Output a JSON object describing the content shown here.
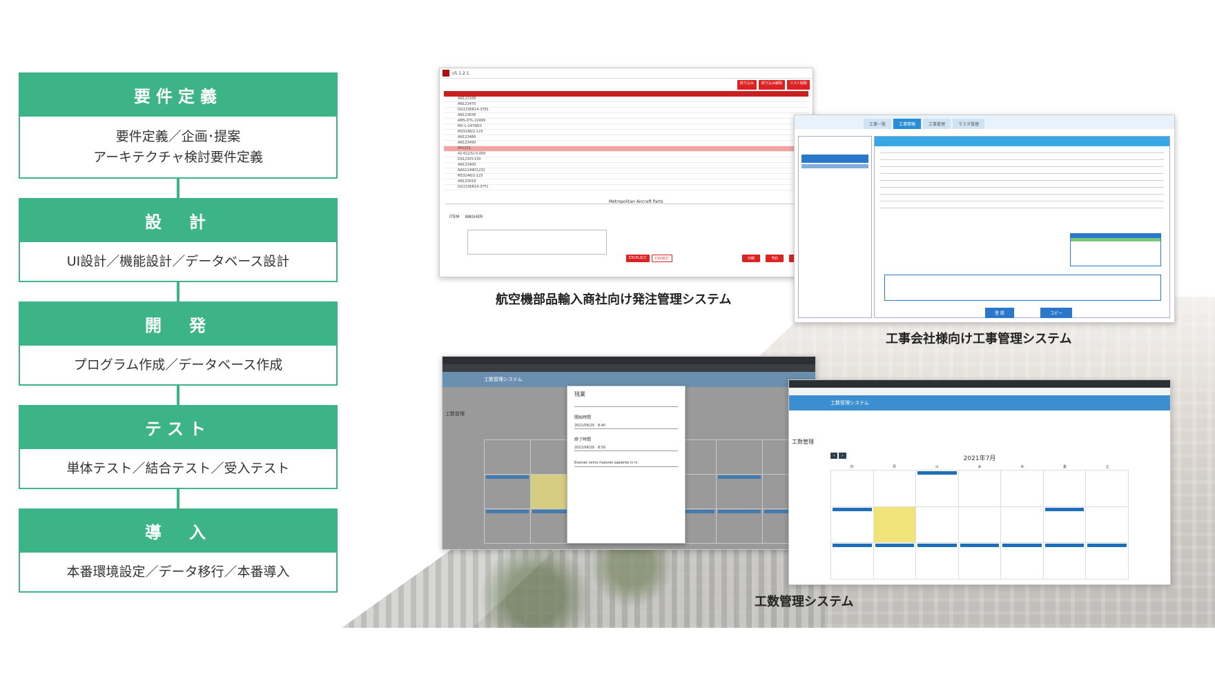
{
  "process_steps": [
    {
      "title": "要件定義",
      "lines": [
        "要件定義／企画･提案",
        "アーキテクチャ検討要件定義"
      ]
    },
    {
      "title": "設　計",
      "lines": [
        "UI設計／機能設計／データベース設計"
      ]
    },
    {
      "title": "開　発",
      "lines": [
        "プログラム作成／データベース作成"
      ]
    },
    {
      "title": "テスト",
      "lines": [
        "単体テスト／結合テスト／受入テスト"
      ]
    },
    {
      "title": "導　入",
      "lines": [
        "本番環境設定／データ移行／本番導入"
      ]
    }
  ],
  "systems": [
    {
      "caption": "航空機部品輸入商社向け発注管理システム"
    },
    {
      "caption": "工事会社様向け工事管理システム"
    },
    {
      "caption": "工数管理システム"
    }
  ],
  "order_app": {
    "version": "v5.1.2.1",
    "buttons": [
      "絞り込み",
      "絞り込み解除",
      "リスト削除"
    ],
    "bottom_buttons": [
      "印刷",
      "予約",
      "戻る"
    ],
    "export_buttons": [
      "EXCEL出力",
      "CSV出力"
    ],
    "supplier": "Metropolitan Aircraft Parts",
    "item_label": "ITEM",
    "item_value": "WASHER",
    "rows": [
      "AN123168",
      "AN123470",
      "DG1336R14-3781",
      "AN123636",
      "AMS-DTL-22499",
      "MS-1-24768/2",
      "MS3248/2-123",
      "AN123480",
      "AN123490",
      "5P1231",
      "42-61232-0-000",
      "DS1230Y-150",
      "AN123400",
      "NAS1149D1232",
      "MS3248/2-123",
      "AN123619",
      "DG1336R14-37F1"
    ]
  },
  "construction_app": {
    "tabs": [
      "工事一覧",
      "工事情報",
      "工事管理",
      "マスタ管理"
    ],
    "register_button": "登 録",
    "copy_button": "コピー"
  },
  "workhours_app_1": {
    "app_title": "工数管理システム",
    "page_title": "工数管理",
    "modal": {
      "title": "残業",
      "start_label": "開始時間",
      "start_date": "2021/06/29",
      "start_time": "8:40",
      "end_label": "終了時間",
      "end_date": "2021/06/29",
      "end_time": "8:50",
      "note": "Eveniet nemo maiores sapiente in in."
    }
  },
  "workhours_app_2": {
    "app_title": "工数管理システム",
    "page_title": "工数管理",
    "month": "2021年7月",
    "weekdays": [
      "日",
      "月",
      "火",
      "水",
      "木",
      "金",
      "土"
    ]
  }
}
